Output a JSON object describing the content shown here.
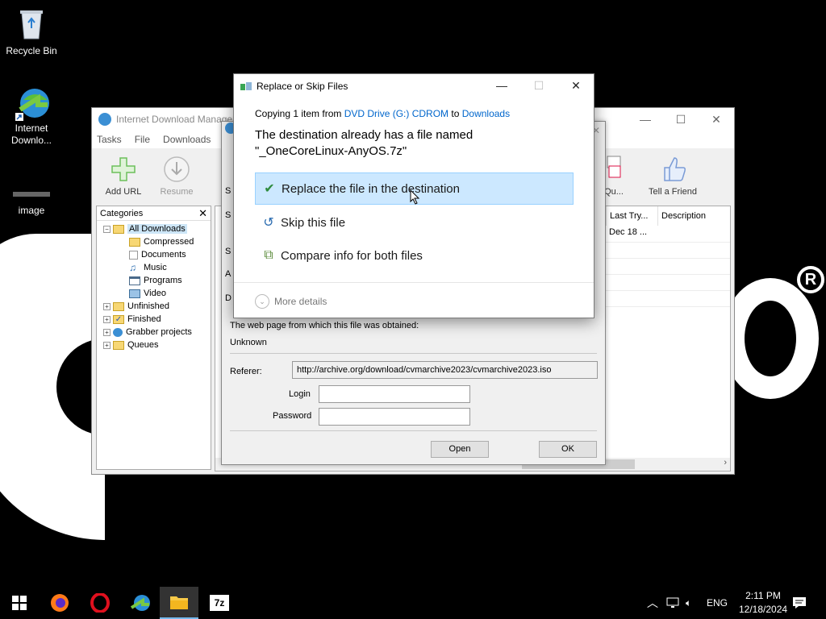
{
  "desktop": {
    "icons": [
      {
        "label": "Recycle Bin"
      },
      {
        "label": "Internet Downlo..."
      },
      {
        "label": "image"
      }
    ]
  },
  "idm": {
    "title": "Internet Download Manager",
    "menu": [
      "Tasks",
      "File",
      "Downloads",
      "V"
    ],
    "toolbar": {
      "add_url": "Add URL",
      "resume": "Resume",
      "queue": "Qu...",
      "tell_friend": "Tell a Friend"
    },
    "categories": {
      "header": "Categories",
      "items": [
        {
          "label": "All Downloads",
          "level": 0
        },
        {
          "label": "Compressed",
          "level": 1
        },
        {
          "label": "Documents",
          "level": 1
        },
        {
          "label": "Music",
          "level": 1
        },
        {
          "label": "Programs",
          "level": 1
        },
        {
          "label": "Video",
          "level": 1
        },
        {
          "label": "Unfinished",
          "level": 0
        },
        {
          "label": "Finished",
          "level": 0
        },
        {
          "label": "Grabber projects",
          "level": 0
        },
        {
          "label": "Queues",
          "level": 0
        }
      ]
    },
    "columns": {
      "last_try": "Last Try...",
      "description": "Description"
    },
    "row": {
      "last_try": "Dec 18 ..."
    }
  },
  "props": {
    "webpage_label": "The web page from which this file was obtained:",
    "webpage_value": "Unknown",
    "referer_label": "Referer:",
    "referer_value": "http://archive.org/download/cvmarchive2023/cvmarchive2023.iso",
    "login_label": "Login",
    "password_label": "Password",
    "open_button": "Open",
    "ok_button": "OK"
  },
  "replace_dialog": {
    "title": "Replace or Skip Files",
    "copy_prefix": "Copying 1 item from ",
    "copy_source": "DVD Drive (G:) CDROM",
    "copy_mid": " to ",
    "copy_dest": "Downloads",
    "dest_line1": "The destination already has a file named",
    "dest_line2": "\"_OneCoreLinux-AnyOS.7z\"",
    "option_replace": "Replace the file in the destination",
    "option_skip": "Skip this file",
    "option_compare": "Compare info for both files",
    "more_details": "More details"
  },
  "taskbar": {
    "lang": "ENG",
    "time": "2:11 PM",
    "date": "12/18/2024"
  }
}
